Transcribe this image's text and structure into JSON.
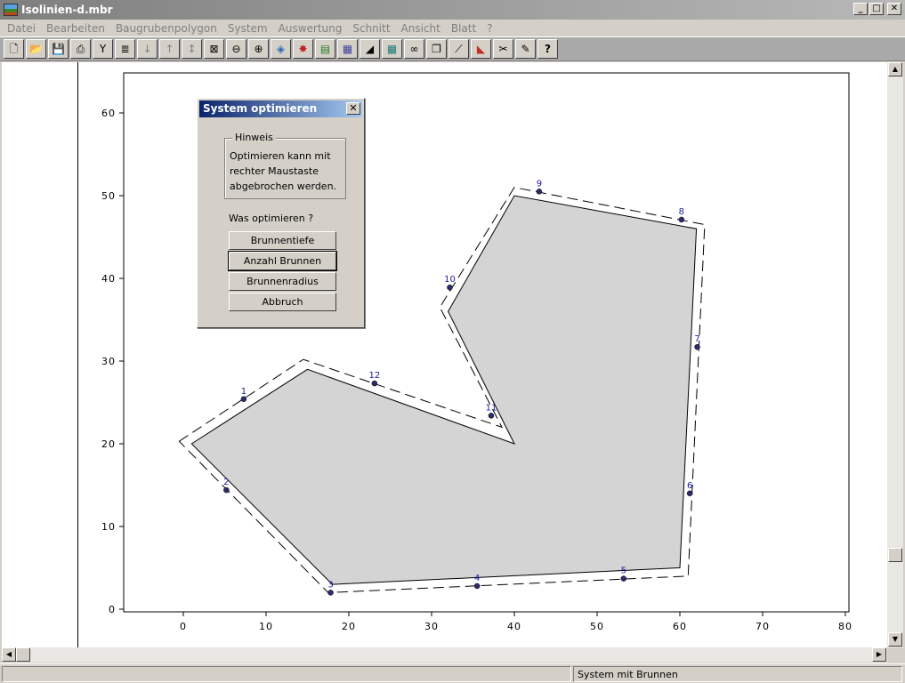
{
  "window": {
    "title": "Isolinien-d.mbr"
  },
  "menu": [
    "Datei",
    "Bearbeiten",
    "Baugrubenpolygon",
    "System",
    "Auswertung",
    "Schnitt",
    "Ansicht",
    "Blatt",
    "?"
  ],
  "toolbar": {
    "help_label": "?",
    "icons": [
      "new-file-icon",
      "open-folder-icon",
      "save-icon",
      "print-icon",
      "tool-icon",
      "list-icon",
      "arrow-down-icon",
      "arrow-up-icon",
      "arrow-updown-icon",
      "zoom-extent-icon",
      "zoom-out-icon",
      "zoom-in-icon",
      "view-3d-icon",
      "color-palette-icon",
      "ground-layer-icon",
      "grid-layer-icon",
      "excavation-icon",
      "table-icon",
      "glasses-icon",
      "copy-icon",
      "line-tool-icon",
      "color-fill-icon",
      "cut-icon",
      "paint-icon",
      "help-icon"
    ]
  },
  "dialog": {
    "title": "System optimieren",
    "close_label": "✕",
    "group_label": "Hinweis",
    "hint_text": "Optimieren kann mit rechter Maustaste abgebrochen werden.",
    "question": "Was optimieren ?",
    "buttons": [
      "Brunnentiefe",
      "Anzahl Brunnen",
      "Brunnenradius",
      "Abbruch"
    ],
    "default_button": "Anzahl Brunnen"
  },
  "status": {
    "text": "System mit Brunnen"
  },
  "chart_data": {
    "type": "scatter",
    "xlim": [
      -7,
      80
    ],
    "ylim": [
      -1,
      64
    ],
    "x_ticks": [
      0,
      10,
      20,
      30,
      40,
      50,
      60,
      70,
      80
    ],
    "y_ticks": [
      0,
      10,
      20,
      30,
      40,
      50,
      60
    ],
    "polygon": [
      [
        1,
        20
      ],
      [
        15,
        29
      ],
      [
        40,
        20
      ],
      [
        32,
        36
      ],
      [
        40,
        50
      ],
      [
        62,
        46
      ],
      [
        60,
        5
      ],
      [
        18,
        3
      ]
    ],
    "offset_polygon": [
      [
        -0.5,
        20.3
      ],
      [
        14.5,
        30.2
      ],
      [
        38.5,
        22
      ],
      [
        31,
        36.5
      ],
      [
        40,
        51
      ],
      [
        63,
        46.5
      ],
      [
        61,
        4
      ],
      [
        17.5,
        2
      ]
    ],
    "wells": [
      {
        "label": "1",
        "x": 7.3,
        "y": 25.4
      },
      {
        "label": "2",
        "x": 5.2,
        "y": 14.4
      },
      {
        "label": "3",
        "x": 17.8,
        "y": 2.0
      },
      {
        "label": "4",
        "x": 35.5,
        "y": 2.8
      },
      {
        "label": "5",
        "x": 53.2,
        "y": 3.7
      },
      {
        "label": "6",
        "x": 61.2,
        "y": 14.0
      },
      {
        "label": "7",
        "x": 62.1,
        "y": 31.7
      },
      {
        "label": "8",
        "x": 60.2,
        "y": 47.1
      },
      {
        "label": "9",
        "x": 43.0,
        "y": 50.5
      },
      {
        "label": "10",
        "x": 32.2,
        "y": 38.9
      },
      {
        "label": "11",
        "x": 37.2,
        "y": 23.4
      },
      {
        "label": "12",
        "x": 23.1,
        "y": 27.3
      }
    ],
    "colors": {
      "fill": "#d4d4d4",
      "edge": "#000000",
      "well": "#2b2b6b",
      "label": "#1a1aa0"
    }
  }
}
